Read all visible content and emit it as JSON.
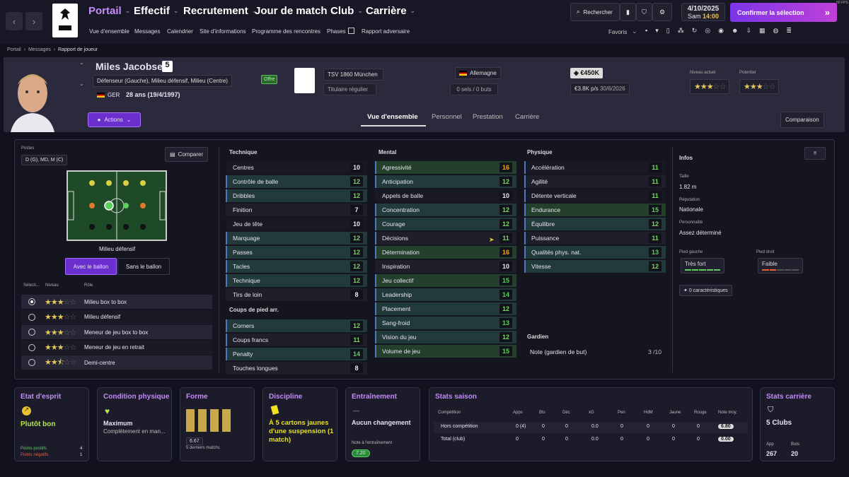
{
  "version": "60 FPS",
  "nav": {
    "back": "‹",
    "forward": "›",
    "menus": [
      "Portail",
      "Effectif",
      "Recrutement",
      "Jour de match",
      "Club",
      "Carrière"
    ],
    "submenu": [
      "Vue d'ensemble",
      "Messages",
      "Calendrier",
      "Site d'informations",
      "Programme des rencontres",
      "Phases",
      "Rapport adversaire"
    ],
    "search": "Rechercher",
    "date": "4/10/2025",
    "day": "Sam",
    "time": "14:00",
    "confirm": "Confirmer la sélection",
    "favoris": "Favoris"
  },
  "breadcrumb": [
    "Portail",
    "Messages",
    "Rapport de joueur"
  ],
  "player": {
    "name": "Miles Jacobsen",
    "number": "5",
    "positions": "Défenseur (Gauche), Milieu défensif, Milieu (Centre)",
    "nation": "GER",
    "age": "28 ans (19/4/1997)",
    "actions": "Actions",
    "offer": "Offre"
  },
  "club": {
    "name": "TSV 1860 München",
    "role": "Titulaire régulier",
    "country": "Allemagne",
    "stats": "0 sels / 0 buts",
    "value": "€450K",
    "wage": "€3.8K p/s",
    "contract": "30/6/2026"
  },
  "levels": {
    "current_label": "Niveau actuel",
    "potential_label": "Potentiel",
    "current": 3,
    "potential": 3
  },
  "tabs": [
    "Vue d'ensemble",
    "Personnel",
    "Prestation",
    "Carrière"
  ],
  "compare": "Comparaison",
  "left": {
    "postes_label": "Postes",
    "postes": "D (G), MD, M (C)",
    "compare_btn": "Comparer",
    "pitch_label": "Milieu défensif",
    "with_ball": "Avec le ballon",
    "without_ball": "Sans le ballon",
    "cols": [
      "Sélecti...",
      "Niveau",
      "Rôle"
    ],
    "roles": [
      {
        "name": "Milieu box to box",
        "stars": 3,
        "selected": true
      },
      {
        "name": "Milieu défensif",
        "stars": 3,
        "selected": false
      },
      {
        "name": "Meneur de jeu box to box",
        "stars": 3,
        "selected": false
      },
      {
        "name": "Meneur de jeu en retrait",
        "stars": 3,
        "selected": false
      },
      {
        "name": "Demi-centre",
        "stars": 2.5,
        "selected": false
      }
    ]
  },
  "technique": {
    "title": "Technique",
    "rows": [
      [
        "Centres",
        "10"
      ],
      [
        "Contrôle de balle",
        "12"
      ],
      [
        "Dribbles",
        "12"
      ],
      [
        "Finition",
        "7"
      ],
      [
        "Jeu de tête",
        "10"
      ],
      [
        "Marquage",
        "12"
      ],
      [
        "Passes",
        "12"
      ],
      [
        "Tacles",
        "12"
      ],
      [
        "Technique",
        "12"
      ],
      [
        "Tirs de loin",
        "8"
      ]
    ]
  },
  "setpieces": {
    "title": "Coups de pied arr.",
    "rows": [
      [
        "Corners",
        "12"
      ],
      [
        "Coups francs",
        "11"
      ],
      [
        "Penalty",
        "14"
      ],
      [
        "Touches longues",
        "8"
      ]
    ]
  },
  "mental": {
    "title": "Mental",
    "rows": [
      [
        "Agressivité",
        "16"
      ],
      [
        "Anticipation",
        "12"
      ],
      [
        "Appels de balle",
        "10"
      ],
      [
        "Concentration",
        "12"
      ],
      [
        "Courage",
        "12"
      ],
      [
        "Décisions",
        "11"
      ],
      [
        "Détermination",
        "16"
      ],
      [
        "Inspiration",
        "10"
      ],
      [
        "Jeu collectif",
        "15"
      ],
      [
        "Leadership",
        "14"
      ],
      [
        "Placement",
        "12"
      ],
      [
        "Sang-froid",
        "13"
      ],
      [
        "Vision du jeu",
        "12"
      ],
      [
        "Volume de jeu",
        "15"
      ]
    ]
  },
  "physique": {
    "title": "Physique",
    "rows": [
      [
        "Accélération",
        "11"
      ],
      [
        "Agilité",
        "11"
      ],
      [
        "Détente verticale",
        "11"
      ],
      [
        "Endurance",
        "15"
      ],
      [
        "Équilibre",
        "12"
      ],
      [
        "Puissance",
        "11"
      ],
      [
        "Qualités phys. nat.",
        "13"
      ],
      [
        "Vitesse",
        "12"
      ]
    ]
  },
  "gardien": {
    "title": "Gardien",
    "label": "Note (gardien de but)",
    "value": "3 /10"
  },
  "infos": {
    "title": "Infos",
    "height_label": "Taille",
    "height": "1.82 m",
    "rep_label": "Réputation",
    "rep": "Nationale",
    "pers_label": "Personnalité",
    "pers": "Assez déterminé",
    "left_foot_label": "Pied gauche",
    "left_foot": "Très fort",
    "right_foot_label": "Pied droit",
    "right_foot": "Faible",
    "traits": "0 caractéristiques"
  },
  "cards": {
    "esprit": {
      "title": "Etat d'esprit",
      "value": "Plutôt bon",
      "pos_label": "Points positifs",
      "pos": "4",
      "neg_label": "Points négatifs",
      "neg": "1"
    },
    "condition": {
      "title": "Condition physique",
      "value": "Maximum",
      "desc": "Complètement en man..."
    },
    "forme": {
      "title": "Forme",
      "rating": "6.67",
      "desc": "5 derniers matchs"
    },
    "discipline": {
      "title": "Discipline",
      "value": "À 5 cartons jaunes d'une suspension (1 match)"
    },
    "entrainement": {
      "title": "Entraînement",
      "dash": "—",
      "value": "Aucun changement",
      "note_label": "Note à l'entraînement",
      "note": "7.20"
    },
    "saison": {
      "title": "Stats saison",
      "cols": [
        "Compétition",
        "Apps",
        "Bts",
        "Déc",
        "xG",
        "Pen",
        "HdM",
        "Jaune",
        "Rouge",
        "Note moy."
      ],
      "rows": [
        [
          "Hors compétition",
          "0 (4)",
          "0",
          "0",
          "0.0",
          "0",
          "0",
          "0",
          "0",
          "6.80"
        ],
        [
          "Total (club)",
          "0",
          "0",
          "0",
          "0.0",
          "0",
          "0",
          "0",
          "0",
          "0.00"
        ]
      ]
    },
    "carriere": {
      "title": "Stats carrière",
      "clubs": "5 Clubs",
      "app_label": "App",
      "app": "267",
      "buts_label": "Buts",
      "buts": "20"
    }
  },
  "colors": {
    "accent": "#8a3df0",
    "green": "#5ecf5e",
    "yellow": "#e0c040",
    "orange": "#e8a030"
  }
}
